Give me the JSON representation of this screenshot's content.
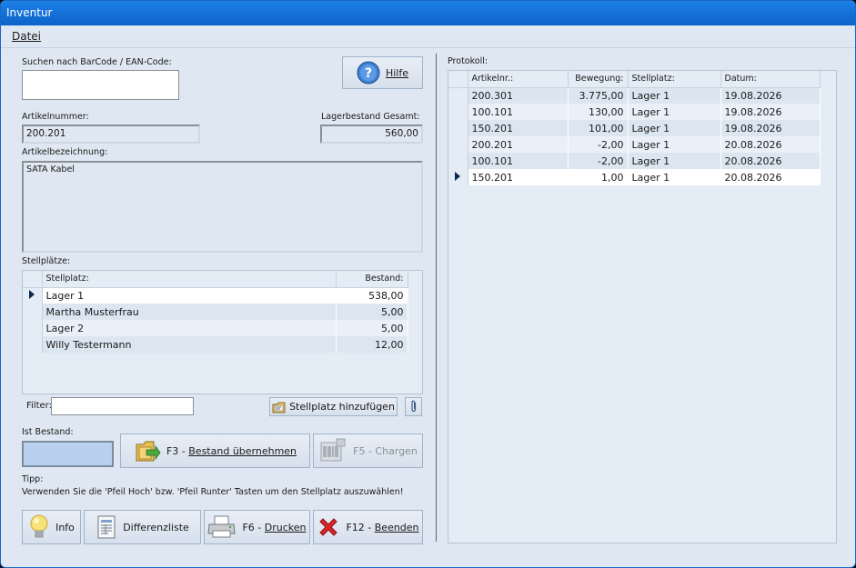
{
  "window": {
    "title": "Inventur"
  },
  "menu": {
    "file": "Datei"
  },
  "search": {
    "label": "Suchen nach BarCode / EAN-Code:",
    "value": ""
  },
  "help_button": {
    "label": "Hilfe"
  },
  "article": {
    "number_label": "Artikelnummer:",
    "number": "200.201",
    "stock_total_label": "Lagerbestand Gesamt:",
    "stock_total": "560,00",
    "description_label": "Artikelbezeichnung:",
    "description": "SATA Kabel"
  },
  "locations": {
    "label": "Stellplätze:",
    "columns": [
      "Stellplatz:",
      "Bestand:"
    ],
    "rows": [
      {
        "name": "Lager 1",
        "stock": "538,00",
        "selected": true
      },
      {
        "name": "Martha Musterfrau",
        "stock": "5,00"
      },
      {
        "name": "Lager 2",
        "stock": "5,00"
      },
      {
        "name": "Willy Testermann",
        "stock": "12,00"
      }
    ]
  },
  "filter": {
    "label": "Filter:",
    "value": ""
  },
  "add_location_button": {
    "label": "Stellplatz hinzufügen"
  },
  "actual_stock": {
    "label": "Ist Bestand:",
    "value": ""
  },
  "apply_button": {
    "prefix": "F3 - ",
    "label": "Bestand übernehmen"
  },
  "batches_button": {
    "label": "F5 - Chargen"
  },
  "tip": {
    "label": "Tipp:",
    "text": "Verwenden Sie die 'Pfeil Hoch' bzw. 'Pfeil Runter' Tasten um den Stellplatz auszuwählen!"
  },
  "footer_buttons": {
    "info": "Info",
    "diff": "Differenzliste",
    "print_prefix": "F6 - ",
    "print": "Drucken",
    "quit_prefix": "F12 - ",
    "quit": "Beenden"
  },
  "protocol": {
    "label": "Protokoll:",
    "columns": [
      "Artikelnr.:",
      "Bewegung:",
      "Stellplatz:",
      "Datum:"
    ],
    "rows": [
      {
        "article": "200.301",
        "movement": "3.775,00",
        "location": "Lager 1",
        "date": "19.08.2026"
      },
      {
        "article": "100.101",
        "movement": "130,00",
        "location": "Lager 1",
        "date": "19.08.2026"
      },
      {
        "article": "150.201",
        "movement": "101,00",
        "location": "Lager 1",
        "date": "19.08.2026"
      },
      {
        "article": "200.201",
        "movement": "-2,00",
        "location": "Lager 1",
        "date": "20.08.2026"
      },
      {
        "article": "100.101",
        "movement": "-2,00",
        "location": "Lager 1",
        "date": "20.08.2026"
      },
      {
        "article": "150.201",
        "movement": "1,00",
        "location": "Lager 1",
        "date": "20.08.2026",
        "selected": true
      }
    ]
  },
  "colors": {
    "titlebar": "#0d63c9",
    "window_bg": "#dfe8f2",
    "accent_quit": "#d9252a"
  }
}
